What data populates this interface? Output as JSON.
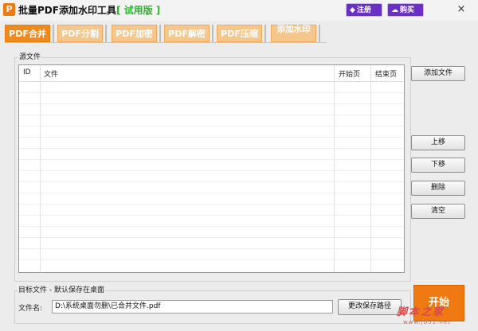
{
  "window": {
    "icon_text": "P",
    "title": "批量PDF添加水印工具",
    "trial": "[ 试用版 ]",
    "register_label": "注册",
    "register_icon": "diamond-icon",
    "buy_label": "购买",
    "buy_icon": "cloud-icon",
    "close_label": "×"
  },
  "tabs": [
    {
      "label": "PDF合并",
      "active": true
    },
    {
      "label": "PDF分割",
      "active": false
    },
    {
      "label": "PDF加密",
      "active": false
    },
    {
      "label": "PDF解密",
      "active": false
    },
    {
      "label": "PDF压缩",
      "active": false
    },
    {
      "label": "添加水印",
      "active": false
    }
  ],
  "source": {
    "group_label": "源文件",
    "columns": [
      "ID",
      "文件",
      "开始页",
      "结束页"
    ]
  },
  "buttons": {
    "add_file": "添加文件",
    "move_up": "上移",
    "move_down": "下移",
    "delete": "删除",
    "clear": "清空"
  },
  "target": {
    "group_label": "目标文件 - 默认保存在桌面",
    "filename_label": "文件名:",
    "filename_value": "D:\\系统桌面勿删\\已合并文件.pdf",
    "change_path": "更改保存路径",
    "start_label": "开始"
  },
  "watermark": {
    "text": "脚本之家",
    "url": "www.jb51.net"
  },
  "colors": {
    "accent": "#f07a12",
    "tab_inactive": "#f6c68a",
    "purple": "#6a2fc4",
    "trial_green": "#2bb52b"
  }
}
